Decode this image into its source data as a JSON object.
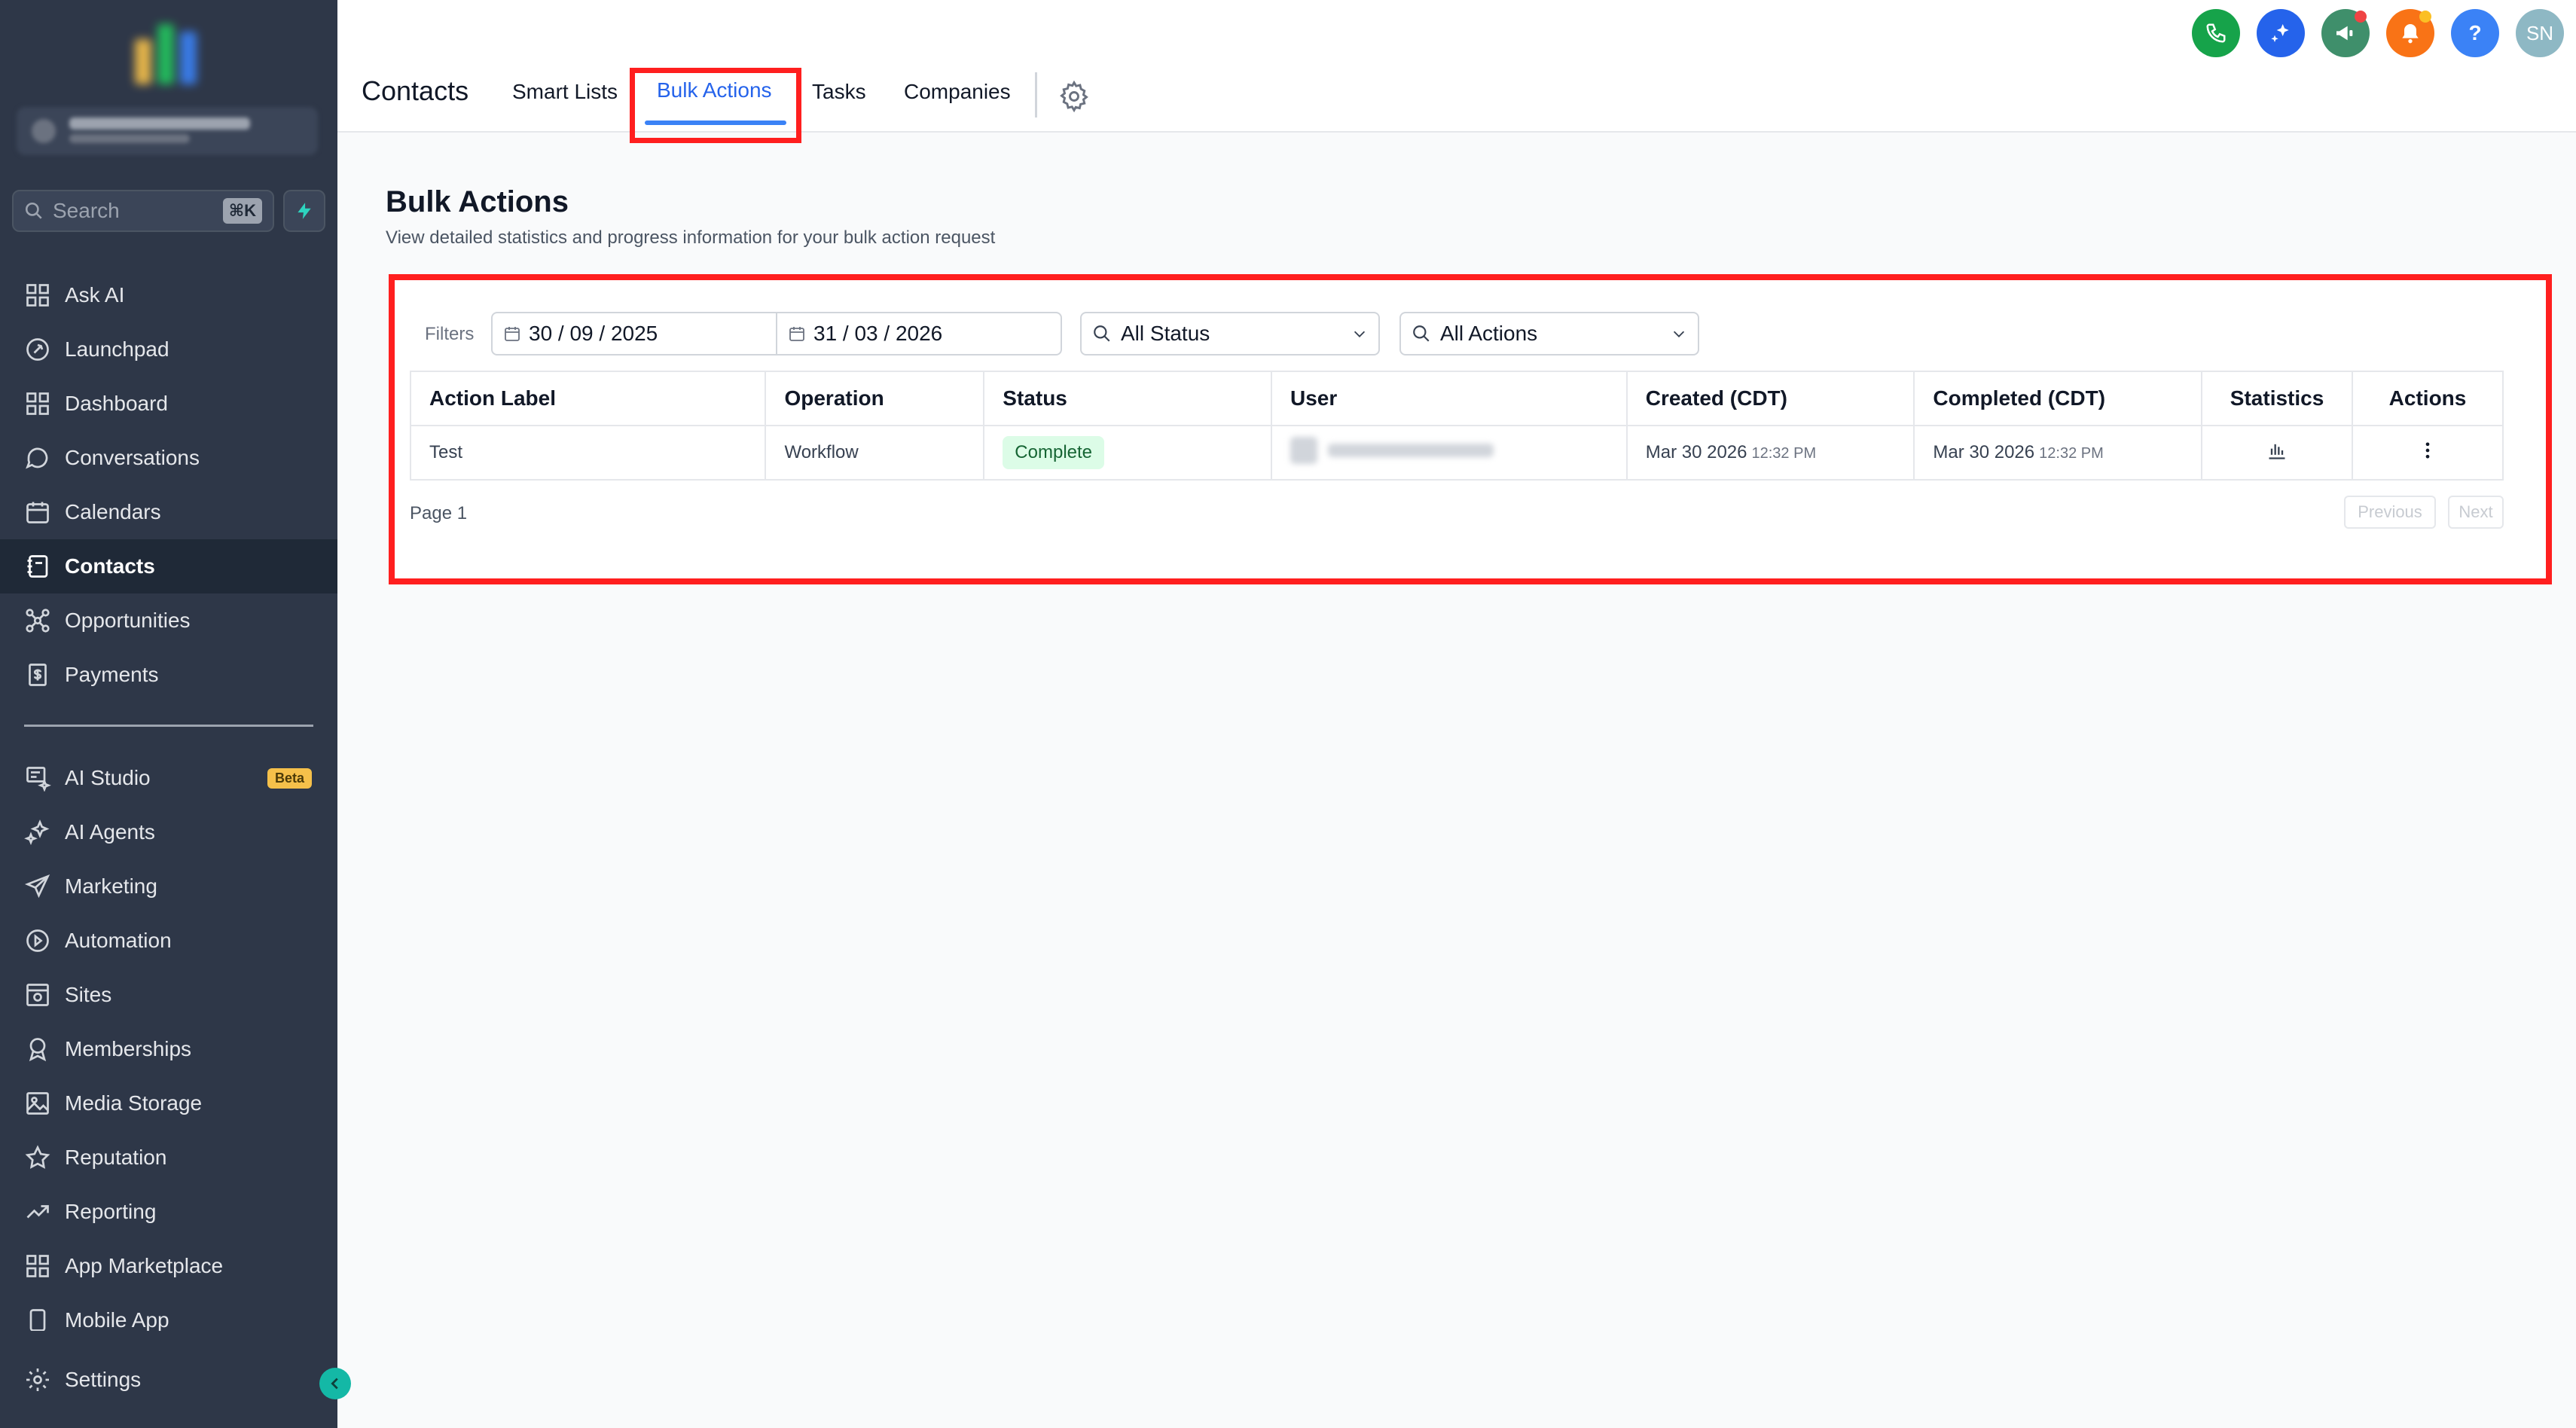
{
  "header": {
    "title": "Contacts",
    "tabs": [
      {
        "label": "Smart Lists"
      },
      {
        "label": "Bulk Actions"
      },
      {
        "label": "Tasks"
      },
      {
        "label": "Companies"
      }
    ],
    "avatar_initials": "SN"
  },
  "sidebar": {
    "search_label": "Search",
    "search_shortcut": "⌘K",
    "items": [
      {
        "label": "Ask AI",
        "icon": "grid-icon"
      },
      {
        "label": "Launchpad",
        "icon": "rocket-icon"
      },
      {
        "label": "Dashboard",
        "icon": "grid-icon"
      },
      {
        "label": "Conversations",
        "icon": "chat-icon"
      },
      {
        "label": "Calendars",
        "icon": "calendar-icon"
      },
      {
        "label": "Contacts",
        "icon": "contacts-icon"
      },
      {
        "label": "Opportunities",
        "icon": "network-icon"
      },
      {
        "label": "Payments",
        "icon": "payment-icon"
      }
    ],
    "items2": [
      {
        "label": "AI Studio",
        "icon": "ai-studio-icon",
        "badge": "Beta"
      },
      {
        "label": "AI Agents",
        "icon": "sparkle-icon"
      },
      {
        "label": "Marketing",
        "icon": "send-icon"
      },
      {
        "label": "Automation",
        "icon": "automation-icon"
      },
      {
        "label": "Sites",
        "icon": "sites-icon"
      },
      {
        "label": "Memberships",
        "icon": "badge-icon"
      },
      {
        "label": "Media Storage",
        "icon": "image-icon"
      },
      {
        "label": "Reputation",
        "icon": "star-icon"
      },
      {
        "label": "Reporting",
        "icon": "trend-icon"
      },
      {
        "label": "App Marketplace",
        "icon": "grid-icon"
      },
      {
        "label": "Mobile App",
        "icon": "phone-icon"
      }
    ],
    "settings_label": "Settings"
  },
  "main": {
    "title": "Bulk Actions",
    "subtitle": "View detailed statistics and progress information for your bulk action request",
    "filters_label": "Filters",
    "date_start": "30 / 09 / 2025",
    "date_end": "31 / 03 / 2026",
    "status_filter": "All Status",
    "actions_filter": "All Actions",
    "table": {
      "headers": [
        "Action Label",
        "Operation",
        "Status",
        "User",
        "Created (CDT)",
        "Completed (CDT)",
        "Statistics",
        "Actions"
      ],
      "rows": [
        {
          "action_label": "Test",
          "operation": "Workflow",
          "status": "Complete",
          "created_date": "Mar 30 2026",
          "created_time": "12:32 PM",
          "completed_date": "Mar 30 2026",
          "completed_time": "12:32 PM"
        }
      ]
    },
    "page_label": "Page 1",
    "previous_label": "Previous",
    "next_label": "Next"
  },
  "colors": {
    "sidebar_bg": "#2e3748",
    "accent_blue": "#2563eb",
    "highlight_red": "#ff1f1f",
    "status_green_bg": "#dcfce7"
  }
}
